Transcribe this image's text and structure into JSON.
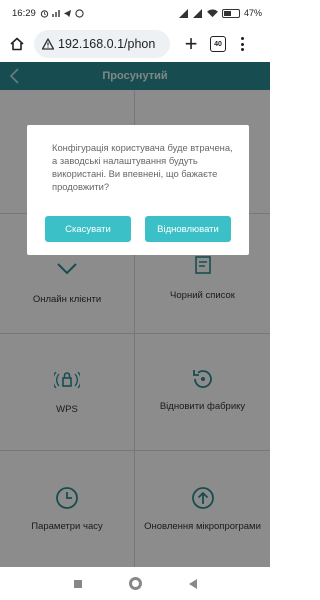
{
  "status_bar": {
    "time": "16:29",
    "left_icons": [
      "alarm-icon",
      "signal-icon",
      "telegram-icon",
      "viber-icon"
    ],
    "right_icons": [
      "cellular-icon",
      "cellular-icon",
      "wifi-icon",
      "battery-icon"
    ],
    "battery_percent": "47"
  },
  "browser": {
    "url": "192.168.0.1/phon",
    "tab_count": "40",
    "icons": [
      "home-icon",
      "warning-icon",
      "plus-icon",
      "tabs-icon",
      "menu-icon"
    ]
  },
  "app": {
    "title": "Просунутий",
    "grid": [
      {
        "label": "Онлайн клієнти",
        "icon": "online-clients-icon"
      },
      {
        "label": "Чорний список",
        "icon": "blacklist-icon"
      },
      {
        "label": "WPS",
        "icon": "wps-lock-icon"
      },
      {
        "label": "Відновити фабрику",
        "icon": "restore-icon"
      },
      {
        "label": "Параметри часу",
        "icon": "clock-icon"
      },
      {
        "label": "Оновлення мікропрограми",
        "icon": "upgrade-icon"
      }
    ],
    "accent_color": "#2a8d93"
  },
  "dialog": {
    "message": "Конфігурація користувача буде втрачена, а заводські налаштування будуть використані. Ви впевнені, що бажаєте продовжити?",
    "cancel_label": "Скасувати",
    "confirm_label": "Відновлювати",
    "button_color": "#3cc0c7"
  },
  "nav_bar": {
    "icons": [
      "recents-icon",
      "home-icon",
      "back-icon"
    ]
  }
}
